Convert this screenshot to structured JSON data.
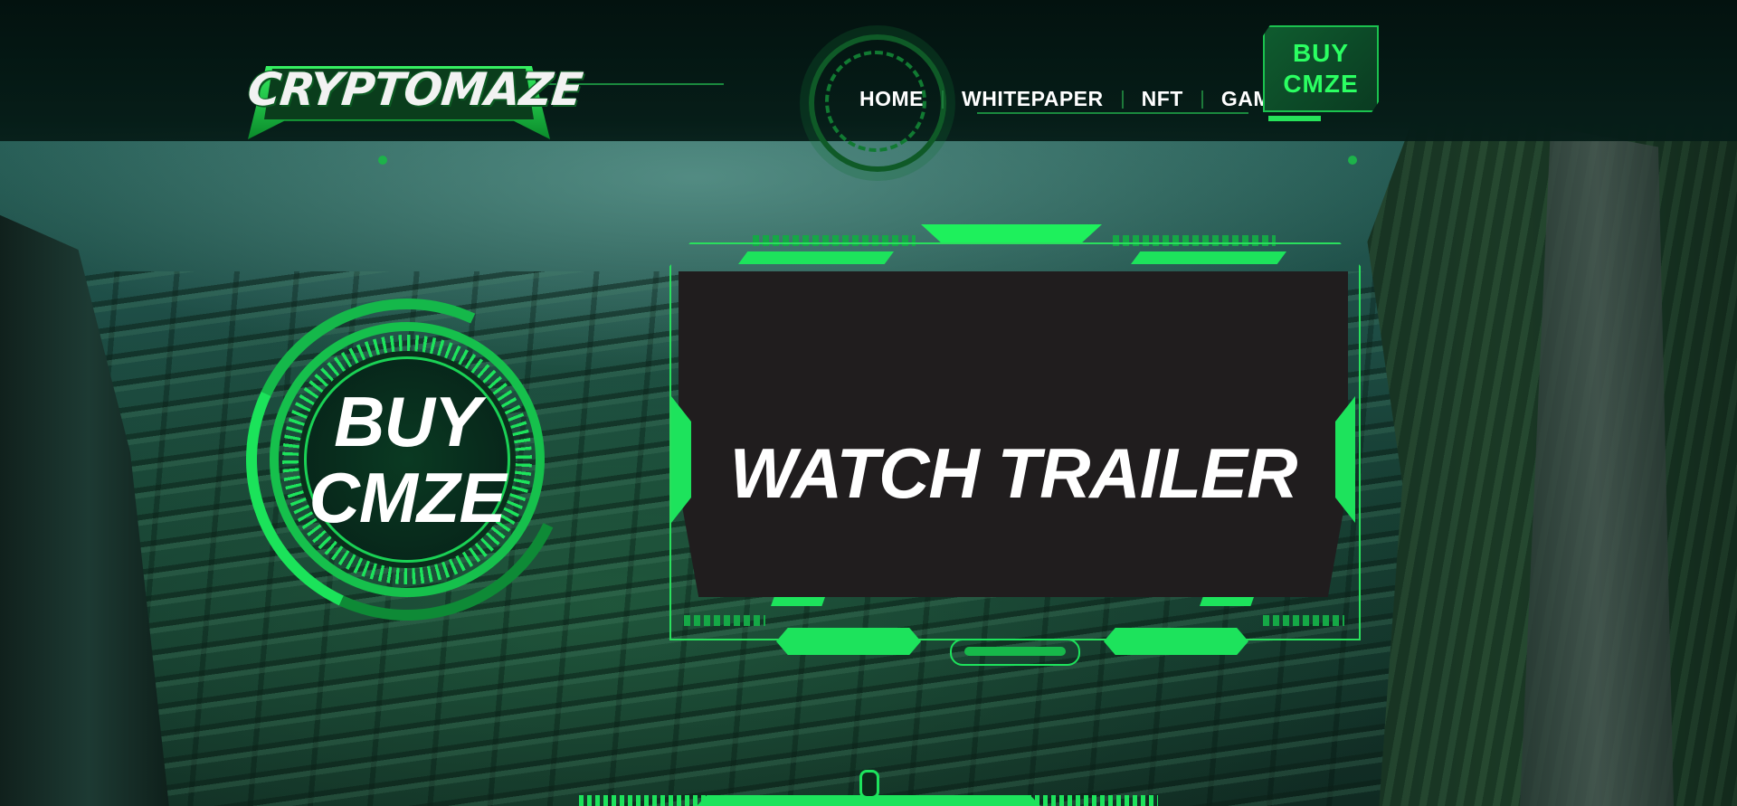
{
  "header": {
    "logo_text": "CRYPTOMAZE",
    "nav": [
      {
        "label": "HOME"
      },
      {
        "label": "WHITEPAPER"
      },
      {
        "label": "NFT"
      },
      {
        "label": "GAMING"
      }
    ],
    "buy_button": {
      "line1": "BUY",
      "line2": "CMZE"
    }
  },
  "hero": {
    "circle_button": {
      "line1": "BUY",
      "line2": "CMZE"
    },
    "trailer_label": "WATCH TRAILER"
  },
  "colors": {
    "accent": "#1de35c",
    "header_bg": "#03120f",
    "screen_bg": "#201d1e"
  },
  "icons": [
    "logo-badge",
    "hud-ring",
    "circular-hud"
  ]
}
